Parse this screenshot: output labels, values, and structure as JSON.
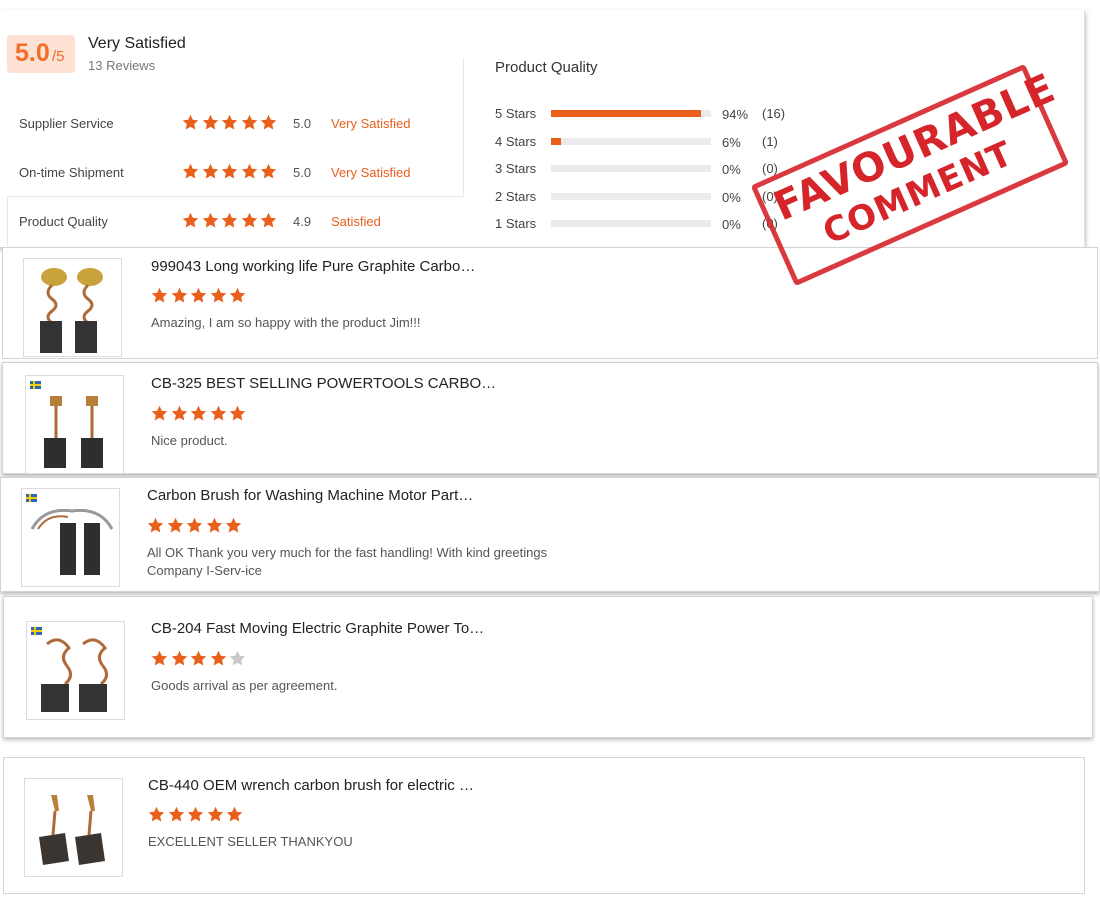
{
  "summary": {
    "score": "5.0",
    "score_suffix": "/5",
    "label": "Very Satisfied",
    "reviews": "13 Reviews",
    "metrics": [
      {
        "name": "Supplier Service",
        "stars": 5,
        "score": "5.0",
        "text": "Very Satisfied"
      },
      {
        "name": "On-time Shipment",
        "stars": 5,
        "score": "5.0",
        "text": "Very Satisfied"
      },
      {
        "name": "Product Quality",
        "stars": 5,
        "score": "4.9",
        "text": "Satisfied"
      }
    ],
    "quality_title": "Product Quality",
    "distribution": [
      {
        "label": "5  Stars",
        "fraction": 0.94,
        "pct": "94%",
        "count": "(16)"
      },
      {
        "label": "4  Stars",
        "fraction": 0.06,
        "pct": "6%",
        "count": "(1)"
      },
      {
        "label": "3  Stars",
        "fraction": 0,
        "pct": "0%",
        "count": "(0)"
      },
      {
        "label": "2  Stars",
        "fraction": 0,
        "pct": "0%",
        "count": "(0)"
      },
      {
        "label": "1  Stars",
        "fraction": 0,
        "pct": "0%",
        "count": "(0)"
      }
    ]
  },
  "stamp": {
    "line1": "FAVOURABLE",
    "line2": "COMMENT"
  },
  "reviews": [
    {
      "title": "999043 Long working life Pure Graphite Carbo…",
      "stars": 5,
      "comment": "Amazing, I am so happy with the product Jim!!!",
      "flag": false
    },
    {
      "title": "CB-325 BEST SELLING POWERTOOLS CARBO…",
      "stars": 5,
      "comment": "Nice product.",
      "flag": true
    },
    {
      "title": "Carbon Brush for Washing Machine Motor Part…",
      "stars": 5,
      "comment": "All OK Thank you very much for the fast handling! With kind greetings",
      "comment2": "Company I-Serv-ice",
      "flag": true
    },
    {
      "title": "CB-204 Fast Moving Electric Graphite Power To…",
      "stars": 4,
      "comment": "Goods arrival as per agreement.",
      "flag": true
    },
    {
      "title": "CB-440 OEM wrench carbon brush for electric …",
      "stars": 5,
      "comment": "EXCELLENT SELLER THANKYOU",
      "flag": false
    }
  ],
  "colors": {
    "accent": "#e8601c",
    "star_empty": "#c8c8c8",
    "stamp": "#d6252a"
  }
}
